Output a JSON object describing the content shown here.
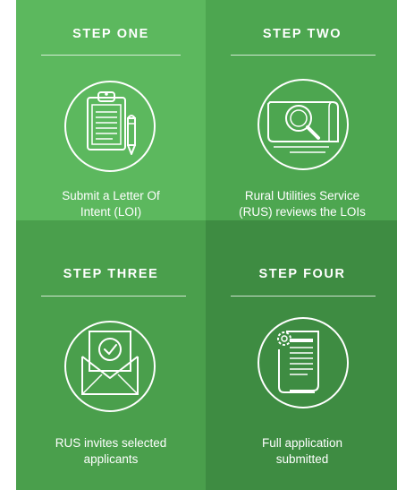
{
  "steps": [
    {
      "title": "STEP ONE",
      "lines": [
        "Submit a Letter Of",
        "Intent (LOI)"
      ],
      "icon": "clipboard-pencil-icon"
    },
    {
      "title": "STEP TWO",
      "lines": [
        "Rural Utilities Service",
        "(RUS) reviews the LOIs"
      ],
      "icon": "magnifier-scroll-icon"
    },
    {
      "title": "STEP THREE",
      "lines": [
        "RUS invites selected",
        "applicants"
      ],
      "icon": "envelope-check-icon"
    },
    {
      "title": "STEP FOUR",
      "lines": [
        "Full application",
        "submitted"
      ],
      "icon": "document-gear-icon"
    }
  ],
  "colors": {
    "step1": "#5cb85e",
    "step2": "#4da650",
    "step3": "#4a9f4c",
    "step4": "#3e8c42",
    "foreground": "#ffffff"
  }
}
